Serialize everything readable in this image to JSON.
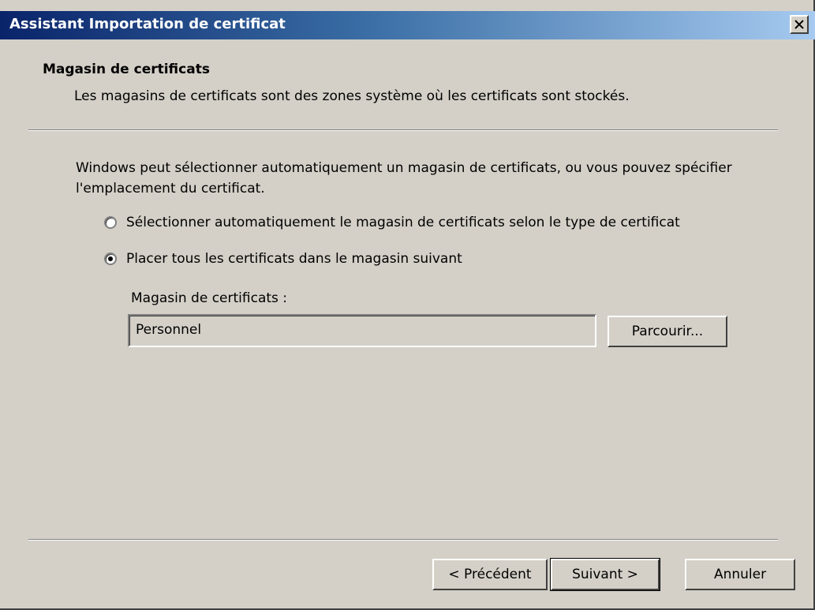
{
  "window": {
    "title": "Assistant Importation de certificat"
  },
  "header": {
    "title": "Magasin de certificats",
    "subtitle": "Les magasins de certificats sont des zones système où les certificats sont stockés."
  },
  "body": {
    "intro": "Windows peut sélectionner automatiquement un magasin de certificats, ou vous pouvez spécifier l'emplacement du certificat.",
    "options": [
      {
        "label": "Sélectionner automatiquement le magasin de certificats selon le type de certificat",
        "checked": false
      },
      {
        "label": "Placer tous les certificats dans le magasin suivant",
        "checked": true
      }
    ],
    "store_label": "Magasin de certificats :",
    "store_value": "Personnel",
    "browse_label": "Parcourir..."
  },
  "footer": {
    "back_label": "< Précédent",
    "next_label": "Suivant >",
    "cancel_label": "Annuler"
  },
  "icons": {
    "close": "close-icon"
  },
  "colors": {
    "dialog_bg": "#d4d0c8",
    "title_gradient_start": "#0a246a",
    "title_gradient_end": "#a6caf0",
    "title_text": "#ffffff"
  }
}
